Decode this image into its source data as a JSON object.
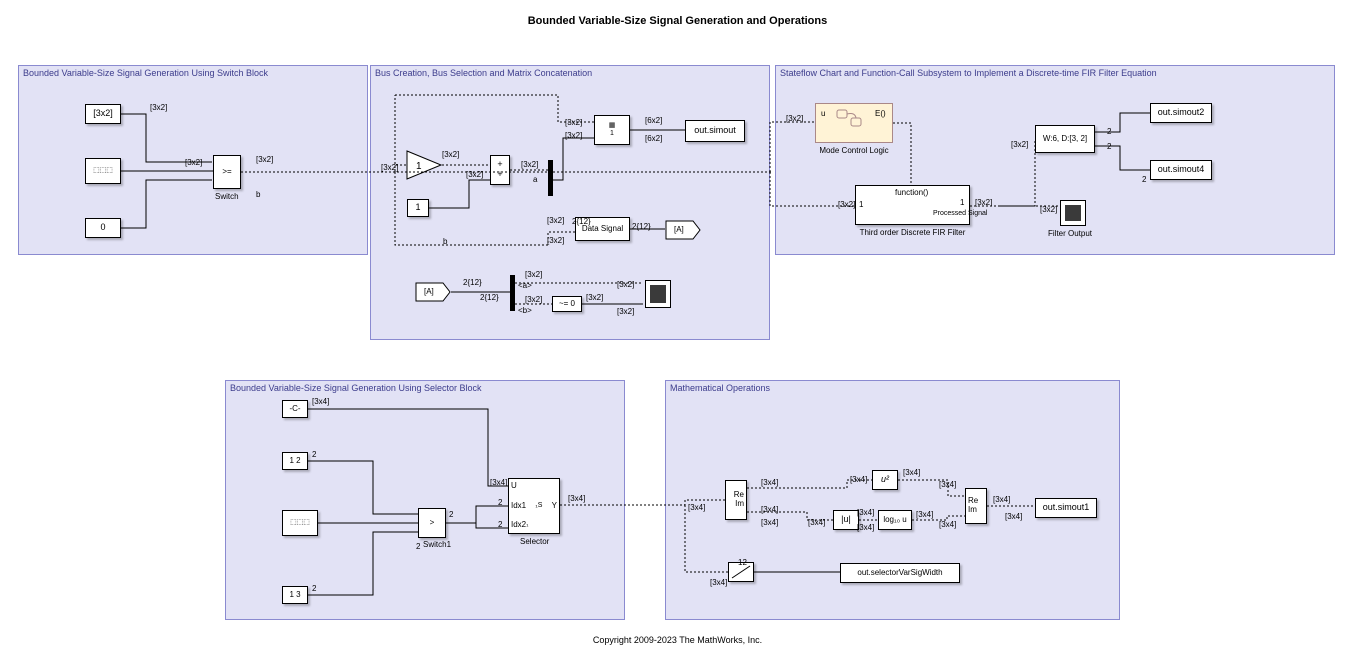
{
  "title": "Bounded Variable-Size Signal Generation and Operations",
  "footer": "Copyright 2009-2023 The MathWorks, Inc.",
  "regions": {
    "r1": "Bounded Variable-Size Signal Generation Using Switch Block",
    "r2": "Bus Creation, Bus Selection and Matrix Concatenation",
    "r3": "Stateflow Chart and Function-Call Subsystem to Implement a Discrete-time FIR Filter Equation",
    "r4": "Bounded Variable-Size Signal Generation Using Selector Block",
    "r5": "Mathematical Operations"
  },
  "blocks": {
    "const3x2": "[3x2]",
    "zero": "0",
    "switch": "Switch",
    "switch1": "Switch1",
    "gain1": "1",
    "const1": "1",
    "simout": "out.simout",
    "gotoA": "[A]",
    "fromA": "[A]",
    "neq": "~= 0",
    "modeCtrl": "Mode Control Logic",
    "fir": "Third order Discrete FIR Filter",
    "firFunc": "function()",
    "firPort1": "1",
    "firPortOut": "1",
    "firProcessed": "Processed Signal",
    "wd": "W:6, D:[3, 2]",
    "simout2": "out.simout2",
    "simout4": "out.simout4",
    "filterOut": "Filter Output",
    "constC": "-C-",
    "const12": "1  2",
    "const13": "1  3",
    "selector": "Selector",
    "selU": "U",
    "selIdx1": "Idx1",
    "selIdx2": "Idx2",
    "selY": "Y",
    "selS": "S",
    "sel1a": "1",
    "sel1b": "1",
    "re": "Re",
    "im": "Im",
    "u2": "u²",
    "abs": "|u|",
    "log10": "log₁₀ u",
    "reim2re": "Re",
    "reim2im": "Im",
    "simout1": "out.simout1",
    "width12": "12",
    "selVarWidth": "out.selectorVarSigWidth",
    "dataSignal": "Data Signal",
    "chartU": "u",
    "chartE": "E()"
  },
  "dims": {
    "d3x2": "[3x2]",
    "d6x2": "[6x2]",
    "d3x4": "[3x4]",
    "d2": "2",
    "d212": "2{12}",
    "a": "a",
    "b": "b",
    "br_a": "<a>",
    "br_b": "<b>"
  }
}
